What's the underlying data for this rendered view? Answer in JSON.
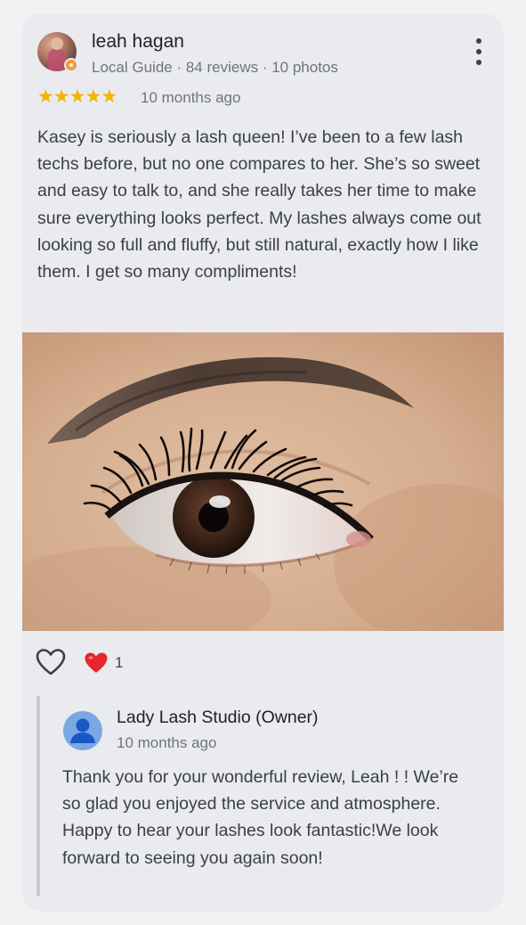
{
  "review": {
    "reviewer_name": "leah hagan",
    "reviewer_meta": "Local Guide · 84 reviews · 10 photos",
    "rating": 5,
    "date": "10 months ago",
    "text": "Kasey is seriously a lash queen! I’ve been to a few lash techs before, but no one compares to her. She’s so sweet and easy to talk to, and she really takes her time to make sure everything looks perfect. My lashes always come out looking so full and fluffy, but still natural, exactly how I like them. I get so many compliments!",
    "photo_icon": "eye-lash-photo"
  },
  "reactions": {
    "like_icon": "heart-outline-icon",
    "reaction_icon": "red-heart-icon",
    "count": "1"
  },
  "owner_reply": {
    "name": "Lady Lash Studio (Owner)",
    "date": "10 months ago",
    "text": "Thank you for your wonderful review, Leah ! ! We’re so glad you enjoyed the service and atmosphere. Happy to hear your lashes look fantastic!We look forward to seeing you again soon!"
  },
  "colors": {
    "star": "#f5b400",
    "heart": "#e8242c",
    "card_bg": "#e9ebee",
    "owner_avatar": "#7ba7e4"
  }
}
